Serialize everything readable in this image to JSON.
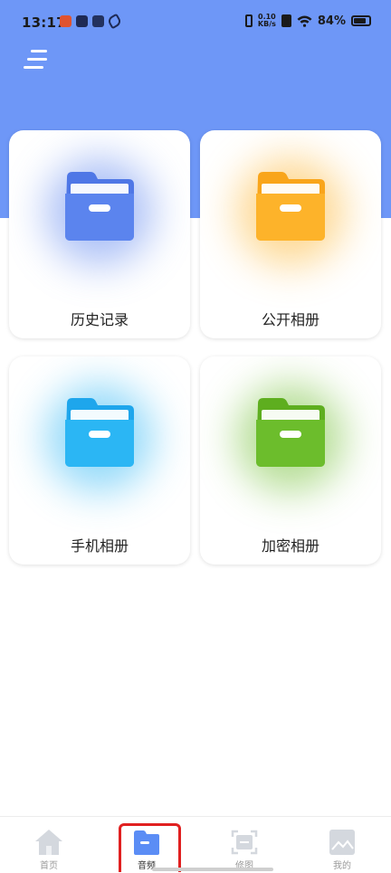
{
  "status_bar": {
    "time": "13:17",
    "net_speed_value": "0.10",
    "net_speed_unit": "KB/s",
    "battery_pct": "84%"
  },
  "header": {
    "bg_color": "#6e97f7",
    "menu_icon": "menu-icon"
  },
  "cards": [
    {
      "label": "历史记录",
      "color": "#5b84ee",
      "icon": "folder-icon"
    },
    {
      "label": "公开相册",
      "color": "#fdb32a",
      "icon": "folder-icon"
    },
    {
      "label": "手机相册",
      "color": "#2bb6f4",
      "icon": "folder-icon"
    },
    {
      "label": "加密相册",
      "color": "#6cbd2c",
      "icon": "folder-icon"
    }
  ],
  "bottom_nav": {
    "items": [
      {
        "label": "首页",
        "icon": "home-icon",
        "active": false
      },
      {
        "label": "音频",
        "icon": "folder-icon",
        "active": true
      },
      {
        "label": "修图",
        "icon": "crop-icon",
        "active": false
      },
      {
        "label": "我的",
        "icon": "image-icon",
        "active": false
      }
    ]
  },
  "colors": {
    "accent": "#5b8df5",
    "highlight": "#e02020"
  }
}
